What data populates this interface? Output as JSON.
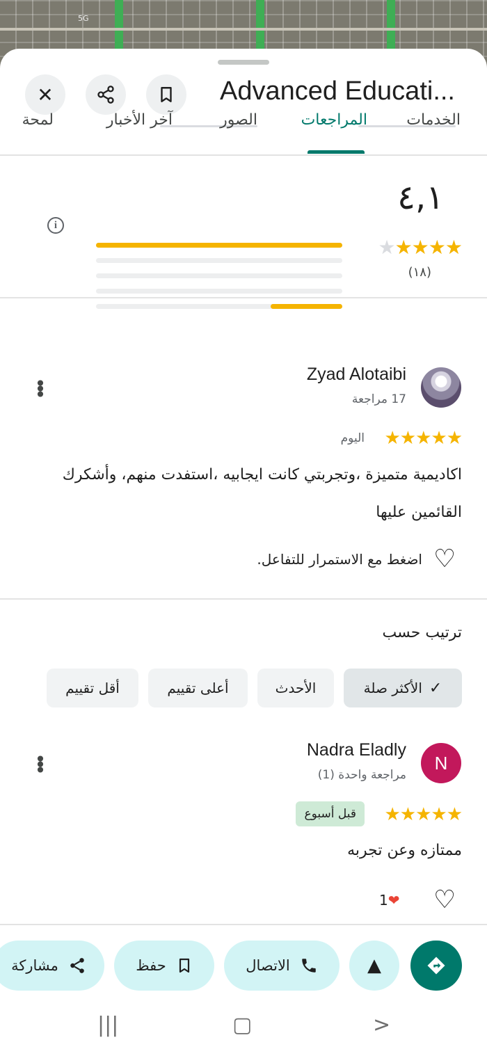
{
  "status_bar": {
    "network": "5G"
  },
  "header": {
    "title": "Advanced Educati...",
    "close_icon": "close-icon",
    "share_icon": "share-icon",
    "bookmark_icon": "bookmark-icon"
  },
  "tabs": [
    {
      "label": "الخدمات",
      "active": false
    },
    {
      "label": "المراجعات",
      "active": true
    },
    {
      "label": "الصور",
      "active": false
    },
    {
      "label": "آخر الأخبار",
      "active": false
    },
    {
      "label": "لمحة",
      "active": false
    }
  ],
  "rating_summary": {
    "average": "٤,١",
    "stars_filled": 4,
    "count": "(١٨)",
    "distribution": [
      {
        "stars": 5,
        "fraction": 1.0
      },
      {
        "stars": 4,
        "fraction": 0.0
      },
      {
        "stars": 3,
        "fraction": 0.0
      },
      {
        "stars": 2,
        "fraction": 0.0
      },
      {
        "stars": 1,
        "fraction": 0.29
      }
    ],
    "colors": {
      "star": "#f5b400",
      "accent": "#00796b"
    }
  },
  "reviews": [
    {
      "name": "Zyad Alotaibi",
      "meta": "17 مراجعة",
      "stars": 5,
      "date": "اليوم",
      "text": "اكاديمية متميزة ،وتجربتي كانت ايجابيه ،استفدت منهم، وأشكرك القائمين عليها",
      "interaction": "اضغط مع الاستمرار للتفاعل."
    },
    {
      "name": "Nadra Eladly",
      "avatar_letter": "N",
      "meta": "مراجعة واحدة (1)",
      "stars": 5,
      "date": "قبل أسبوع",
      "text": "ممتازه وعن تجربه",
      "likes": "1"
    }
  ],
  "sort": {
    "title": "ترتيب حسب",
    "options": [
      {
        "label": "الأكثر صلة",
        "selected": true
      },
      {
        "label": "الأحدث",
        "selected": false
      },
      {
        "label": "أعلى تقييم",
        "selected": false
      },
      {
        "label": "أقل تقييم",
        "selected": false
      }
    ]
  },
  "actions": {
    "directions_icon": "directions-icon",
    "navigate_icon": "navigation-arrow-icon",
    "call_label": "الاتصال",
    "save_label": "حفظ",
    "share_label": "مشاركة"
  }
}
